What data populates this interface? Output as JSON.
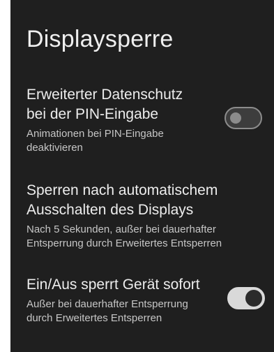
{
  "page": {
    "title": "Displaysperre"
  },
  "settings": [
    {
      "title": "Erweiterter Datenschutz\nbei der PIN-Eingabe",
      "summary": "Animationen bei PIN-Eingabe\ndeaktivieren",
      "toggle": "off"
    },
    {
      "title": "Sperren nach automatischem\nAusschalten des Displays",
      "summary": "Nach 5 Sekunden, außer bei dauerhafter\nEntsperrung durch Erweitertes Entsperren"
    },
    {
      "title": "Ein/Aus sperrt Gerät sofort",
      "summary": "Außer bei dauerhafter Entsperrung\ndurch Erweitertes Entsperren",
      "toggle": "on"
    }
  ],
  "colors": {
    "background": "#1f1f1f",
    "toggle_on": "#d9d9d9",
    "toggle_off": "#3d3d3d"
  }
}
